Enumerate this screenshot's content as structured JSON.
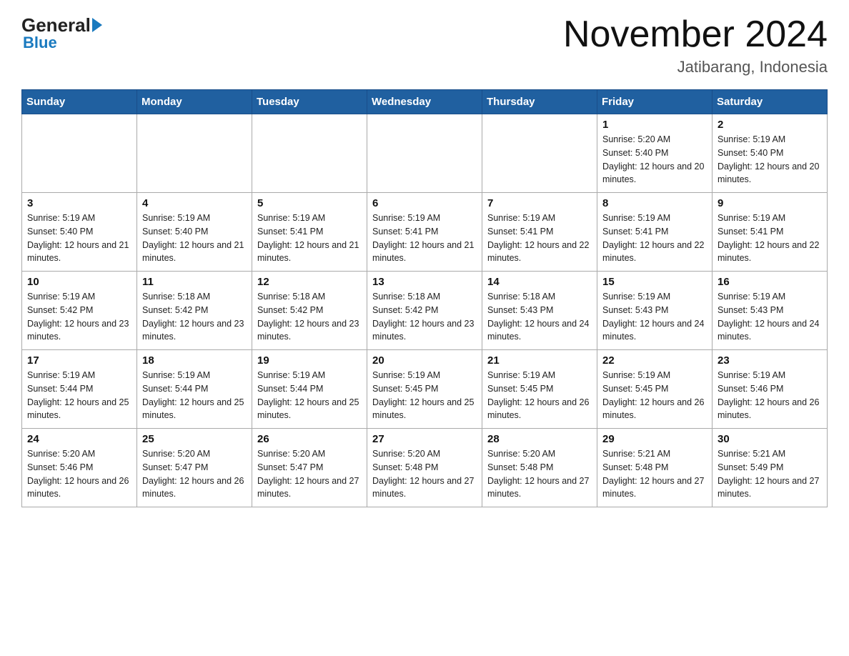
{
  "logo": {
    "text_general": "General",
    "text_blue": "Blue"
  },
  "header": {
    "title": "November 2024",
    "subtitle": "Jatibarang, Indonesia"
  },
  "days_of_week": [
    "Sunday",
    "Monday",
    "Tuesday",
    "Wednesday",
    "Thursday",
    "Friday",
    "Saturday"
  ],
  "weeks": [
    [
      {
        "day": "",
        "sunrise": "",
        "sunset": "",
        "daylight": ""
      },
      {
        "day": "",
        "sunrise": "",
        "sunset": "",
        "daylight": ""
      },
      {
        "day": "",
        "sunrise": "",
        "sunset": "",
        "daylight": ""
      },
      {
        "day": "",
        "sunrise": "",
        "sunset": "",
        "daylight": ""
      },
      {
        "day": "",
        "sunrise": "",
        "sunset": "",
        "daylight": ""
      },
      {
        "day": "1",
        "sunrise": "Sunrise: 5:20 AM",
        "sunset": "Sunset: 5:40 PM",
        "daylight": "Daylight: 12 hours and 20 minutes."
      },
      {
        "day": "2",
        "sunrise": "Sunrise: 5:19 AM",
        "sunset": "Sunset: 5:40 PM",
        "daylight": "Daylight: 12 hours and 20 minutes."
      }
    ],
    [
      {
        "day": "3",
        "sunrise": "Sunrise: 5:19 AM",
        "sunset": "Sunset: 5:40 PM",
        "daylight": "Daylight: 12 hours and 21 minutes."
      },
      {
        "day": "4",
        "sunrise": "Sunrise: 5:19 AM",
        "sunset": "Sunset: 5:40 PM",
        "daylight": "Daylight: 12 hours and 21 minutes."
      },
      {
        "day": "5",
        "sunrise": "Sunrise: 5:19 AM",
        "sunset": "Sunset: 5:41 PM",
        "daylight": "Daylight: 12 hours and 21 minutes."
      },
      {
        "day": "6",
        "sunrise": "Sunrise: 5:19 AM",
        "sunset": "Sunset: 5:41 PM",
        "daylight": "Daylight: 12 hours and 21 minutes."
      },
      {
        "day": "7",
        "sunrise": "Sunrise: 5:19 AM",
        "sunset": "Sunset: 5:41 PM",
        "daylight": "Daylight: 12 hours and 22 minutes."
      },
      {
        "day": "8",
        "sunrise": "Sunrise: 5:19 AM",
        "sunset": "Sunset: 5:41 PM",
        "daylight": "Daylight: 12 hours and 22 minutes."
      },
      {
        "day": "9",
        "sunrise": "Sunrise: 5:19 AM",
        "sunset": "Sunset: 5:41 PM",
        "daylight": "Daylight: 12 hours and 22 minutes."
      }
    ],
    [
      {
        "day": "10",
        "sunrise": "Sunrise: 5:19 AM",
        "sunset": "Sunset: 5:42 PM",
        "daylight": "Daylight: 12 hours and 23 minutes."
      },
      {
        "day": "11",
        "sunrise": "Sunrise: 5:18 AM",
        "sunset": "Sunset: 5:42 PM",
        "daylight": "Daylight: 12 hours and 23 minutes."
      },
      {
        "day": "12",
        "sunrise": "Sunrise: 5:18 AM",
        "sunset": "Sunset: 5:42 PM",
        "daylight": "Daylight: 12 hours and 23 minutes."
      },
      {
        "day": "13",
        "sunrise": "Sunrise: 5:18 AM",
        "sunset": "Sunset: 5:42 PM",
        "daylight": "Daylight: 12 hours and 23 minutes."
      },
      {
        "day": "14",
        "sunrise": "Sunrise: 5:18 AM",
        "sunset": "Sunset: 5:43 PM",
        "daylight": "Daylight: 12 hours and 24 minutes."
      },
      {
        "day": "15",
        "sunrise": "Sunrise: 5:19 AM",
        "sunset": "Sunset: 5:43 PM",
        "daylight": "Daylight: 12 hours and 24 minutes."
      },
      {
        "day": "16",
        "sunrise": "Sunrise: 5:19 AM",
        "sunset": "Sunset: 5:43 PM",
        "daylight": "Daylight: 12 hours and 24 minutes."
      }
    ],
    [
      {
        "day": "17",
        "sunrise": "Sunrise: 5:19 AM",
        "sunset": "Sunset: 5:44 PM",
        "daylight": "Daylight: 12 hours and 25 minutes."
      },
      {
        "day": "18",
        "sunrise": "Sunrise: 5:19 AM",
        "sunset": "Sunset: 5:44 PM",
        "daylight": "Daylight: 12 hours and 25 minutes."
      },
      {
        "day": "19",
        "sunrise": "Sunrise: 5:19 AM",
        "sunset": "Sunset: 5:44 PM",
        "daylight": "Daylight: 12 hours and 25 minutes."
      },
      {
        "day": "20",
        "sunrise": "Sunrise: 5:19 AM",
        "sunset": "Sunset: 5:45 PM",
        "daylight": "Daylight: 12 hours and 25 minutes."
      },
      {
        "day": "21",
        "sunrise": "Sunrise: 5:19 AM",
        "sunset": "Sunset: 5:45 PM",
        "daylight": "Daylight: 12 hours and 26 minutes."
      },
      {
        "day": "22",
        "sunrise": "Sunrise: 5:19 AM",
        "sunset": "Sunset: 5:45 PM",
        "daylight": "Daylight: 12 hours and 26 minutes."
      },
      {
        "day": "23",
        "sunrise": "Sunrise: 5:19 AM",
        "sunset": "Sunset: 5:46 PM",
        "daylight": "Daylight: 12 hours and 26 minutes."
      }
    ],
    [
      {
        "day": "24",
        "sunrise": "Sunrise: 5:20 AM",
        "sunset": "Sunset: 5:46 PM",
        "daylight": "Daylight: 12 hours and 26 minutes."
      },
      {
        "day": "25",
        "sunrise": "Sunrise: 5:20 AM",
        "sunset": "Sunset: 5:47 PM",
        "daylight": "Daylight: 12 hours and 26 minutes."
      },
      {
        "day": "26",
        "sunrise": "Sunrise: 5:20 AM",
        "sunset": "Sunset: 5:47 PM",
        "daylight": "Daylight: 12 hours and 27 minutes."
      },
      {
        "day": "27",
        "sunrise": "Sunrise: 5:20 AM",
        "sunset": "Sunset: 5:48 PM",
        "daylight": "Daylight: 12 hours and 27 minutes."
      },
      {
        "day": "28",
        "sunrise": "Sunrise: 5:20 AM",
        "sunset": "Sunset: 5:48 PM",
        "daylight": "Daylight: 12 hours and 27 minutes."
      },
      {
        "day": "29",
        "sunrise": "Sunrise: 5:21 AM",
        "sunset": "Sunset: 5:48 PM",
        "daylight": "Daylight: 12 hours and 27 minutes."
      },
      {
        "day": "30",
        "sunrise": "Sunrise: 5:21 AM",
        "sunset": "Sunset: 5:49 PM",
        "daylight": "Daylight: 12 hours and 27 minutes."
      }
    ]
  ]
}
